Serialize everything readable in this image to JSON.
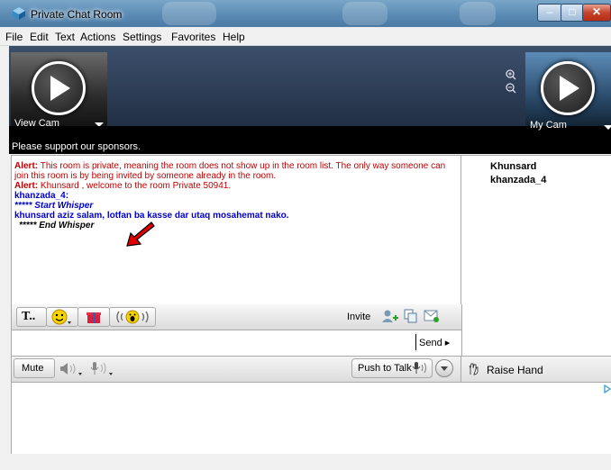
{
  "window": {
    "title": "Private Chat Room"
  },
  "menu": [
    "File",
    "Edit",
    "Text",
    "Actions",
    "Settings",
    "Favorites",
    "Help"
  ],
  "cam": {
    "view_label": "View Cam",
    "my_label": "My Cam",
    "sponsor_text": "Please support our sponsors."
  },
  "chat": {
    "alert1_label": "Alert:",
    "alert1_text": " This room is private, meaning the room does not show up in the room list.  The only way someone can join this room is by being invited by someone already in the room.",
    "alert2_label": "Alert:",
    "alert2_text": " Khunsard , welcome to the room  Private 50941.",
    "sender": "khanzada_4:",
    "whisper_start": "***** Start Whisper",
    "whisper_msg": "khunsard aziz salam, lotfan ba kasse dar utaq mosahemat nako.",
    "whisper_end": "***** End Whisper"
  },
  "users": [
    "Khunsard",
    "khanzada_4"
  ],
  "toolbar": {
    "text_btn": "T..",
    "invite_label": "Invite"
  },
  "input": {
    "value": "",
    "send_label": "Send ▸"
  },
  "audio": {
    "mute_label": "Mute",
    "push_to_talk_label": "Push to Talk"
  },
  "raise_hand": {
    "label": "Raise Hand"
  },
  "colors": {
    "alert": "#c00000",
    "blue": "#0000cc",
    "annotation_arrow": "#e00000"
  }
}
